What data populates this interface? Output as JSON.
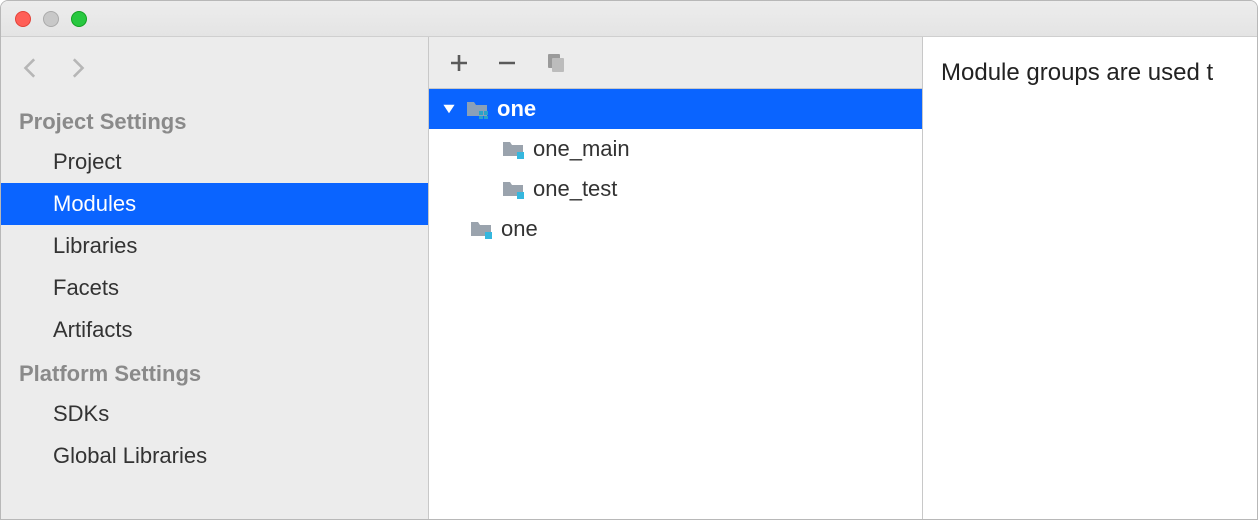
{
  "sidebar": {
    "heading_project": "Project Settings",
    "heading_platform": "Platform Settings",
    "items_project": [
      {
        "label": "Project"
      },
      {
        "label": "Modules"
      },
      {
        "label": "Libraries"
      },
      {
        "label": "Facets"
      },
      {
        "label": "Artifacts"
      }
    ],
    "items_platform": [
      {
        "label": "SDKs"
      },
      {
        "label": "Global Libraries"
      }
    ],
    "selected": "Modules"
  },
  "tree": {
    "nodes": [
      {
        "label": "one",
        "depth": 0,
        "expanded": true,
        "selected": true,
        "kind": "group"
      },
      {
        "label": "one_main",
        "depth": 1,
        "kind": "module"
      },
      {
        "label": "one_test",
        "depth": 1,
        "kind": "module"
      },
      {
        "label": "one",
        "depth": 0,
        "kind": "module"
      }
    ]
  },
  "detail": {
    "text": "Module groups are used t"
  }
}
